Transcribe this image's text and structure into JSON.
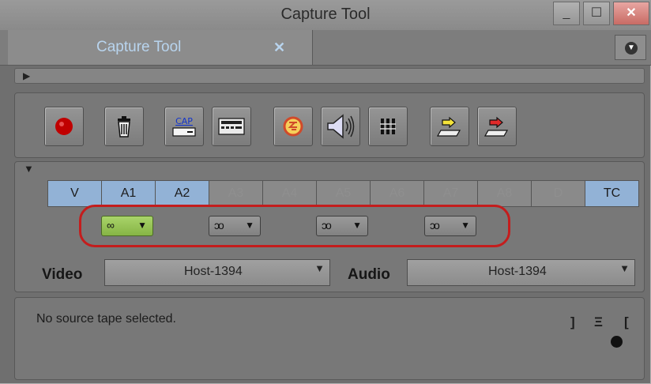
{
  "window": {
    "title": "Capture Tool",
    "minimize_glyph": "_",
    "maximize_glyph": "☐",
    "close_glyph": "✕"
  },
  "tab": {
    "label": "Capture Tool",
    "close_glyph": "✕"
  },
  "toolbar": {
    "buttons": [
      {
        "name": "record-icon"
      },
      {
        "name": "trash-icon"
      },
      {
        "name": "cap-icon",
        "text": "CAP"
      },
      {
        "name": "deck-icon"
      },
      {
        "name": "toggle-source-icon"
      },
      {
        "name": "speaker-icon"
      },
      {
        "name": "audio-meter-icon"
      },
      {
        "name": "bin-target-yellow-icon"
      },
      {
        "name": "bin-target-red-icon"
      }
    ]
  },
  "tracks": [
    "V",
    "A1",
    "A2",
    "A3",
    "A4",
    "A5",
    "A6",
    "A7",
    "A8",
    "D",
    "TC"
  ],
  "tracks_enabled": [
    "V",
    "A1",
    "A2",
    "TC"
  ],
  "audio_pairs": [
    {
      "symbol": "∞",
      "active": true
    },
    {
      "symbol": "ↄo",
      "active": false
    },
    {
      "symbol": "ↄo",
      "active": false
    },
    {
      "symbol": "ↄo",
      "active": false
    }
  ],
  "video": {
    "label": "Video",
    "value": "Host-1394"
  },
  "audio": {
    "label": "Audio",
    "value": "Host-1394"
  },
  "status": {
    "message": "No source tape selected."
  },
  "indicators": {
    "mark_out": "]",
    "timecode": "Ξ",
    "mark_in": "["
  },
  "colors": {
    "track_on": "#92b2d6",
    "audio_link_active": "#a9d46a",
    "highlight_ring": "#c41d1d",
    "tab_label": "#b8d4ee"
  }
}
